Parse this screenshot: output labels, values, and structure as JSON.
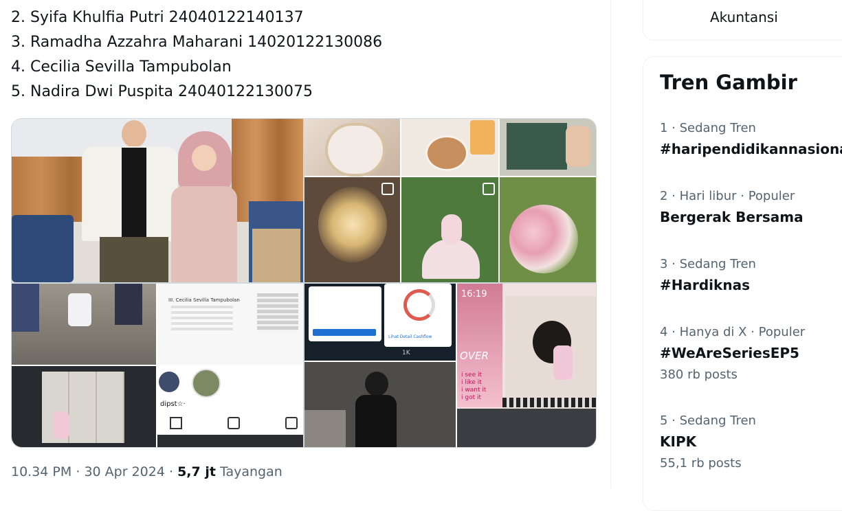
{
  "tweet": {
    "lines": [
      "2. Syifa Khulfia Putri 24040122140137",
      "3. Ramadha Azzahra Maharani 14020122130086",
      "4. Cecilia Sevilla Tampubolan",
      "5. Nadira Dwi Puspita 24040122130075"
    ],
    "time": "10.34 PM",
    "date": "30 Apr 2024",
    "views_count": "5,7 jt",
    "views_label": "Tayangan",
    "separator": "·"
  },
  "media": {
    "screenshot_text": {
      "cashflow_button": "Lihat Detail Cashflow",
      "phone_time": "16:19",
      "collage_text": "OVER",
      "sticker_lines": [
        "i see it",
        "i like it",
        "i want it",
        "i got it"
      ],
      "profile_name": "dipst☆·",
      "list_name": "III. Cecilia Sevilla Tampubolan",
      "stat_count": "1K"
    }
  },
  "sidebar": {
    "previous_card_text": "Akuntansi",
    "trends_title": "Tren Gambir",
    "trends": [
      {
        "context": "1 · Sedang Tren",
        "name": "#haripendidikannasional",
        "count": ""
      },
      {
        "context": "2 · Hari libur · Populer",
        "name": "Bergerak Bersama",
        "count": ""
      },
      {
        "context": "3 · Sedang Tren",
        "name": "#Hardiknas",
        "count": ""
      },
      {
        "context": "4 · Hanya di X · Populer",
        "name": "#WeAreSeriesEP5",
        "count": "380 rb posts"
      },
      {
        "context": "5 · Sedang Tren",
        "name": "KIPK",
        "count": "55,1 rb posts"
      }
    ]
  },
  "colors": {
    "text_primary": "#0f1419",
    "text_secondary": "#536471",
    "border": "#eff3f4"
  }
}
